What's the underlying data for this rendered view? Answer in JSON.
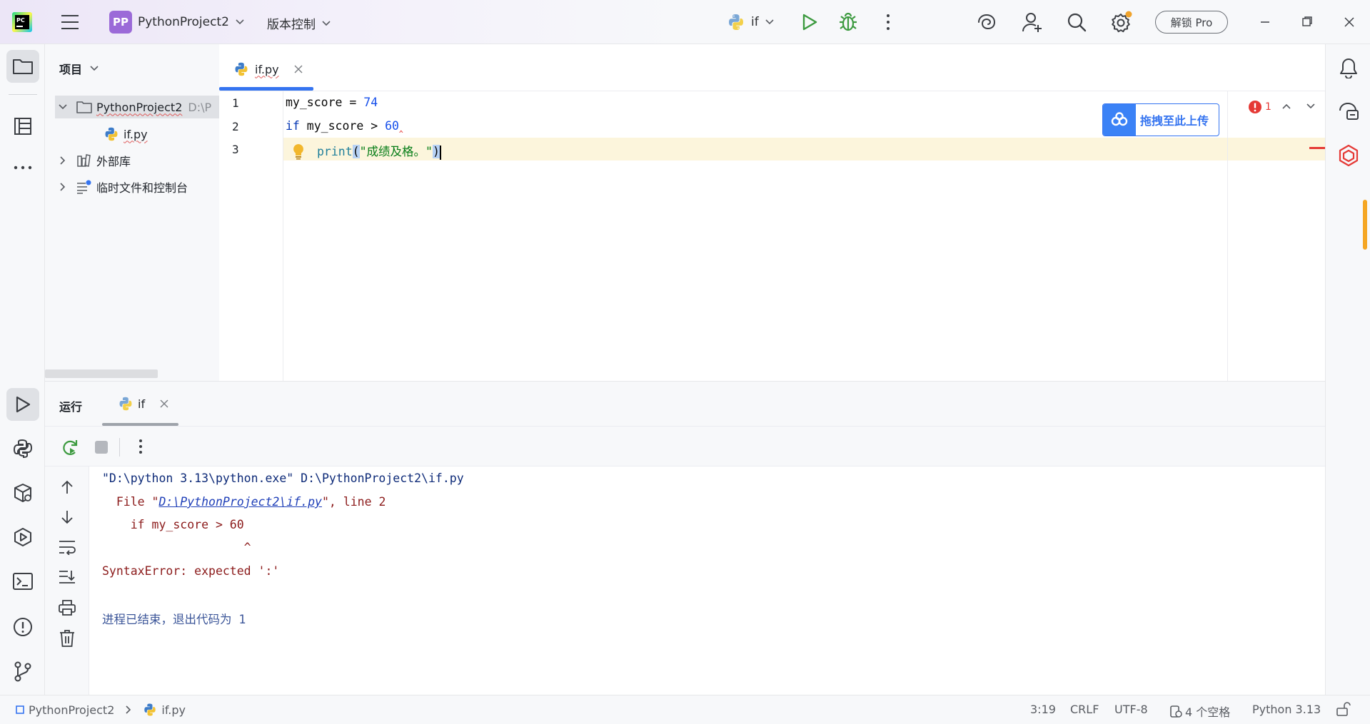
{
  "titlebar": {
    "project_badge": "PP",
    "project_name": "PythonProject2",
    "vcs_label": "版本控制",
    "run_config": "if",
    "pro_button": "解锁 Pro"
  },
  "project_panel": {
    "title": "项目",
    "root_name": "PythonProject2",
    "root_path": "D:\\P",
    "file_name": "if.py",
    "external_libs": "外部库",
    "scratches": "临时文件和控制台"
  },
  "editor": {
    "tab_label": "if.py",
    "error_count": "1",
    "upload_button": "拖拽至此上传",
    "line_numbers": [
      "1",
      "2",
      "3"
    ],
    "code": {
      "l1_var": "my_score",
      "l1_op": " = ",
      "l1_num": "74",
      "l2_kw": "if",
      "l2_var": " my_score ",
      "l2_op": ">",
      "l2_num": " 60",
      "l3_fn": "print",
      "l3_open": "(",
      "l3_str": "\"成绩及格。\"",
      "l3_close": ")"
    }
  },
  "run_panel": {
    "title": "运行",
    "tab_label": "if",
    "console": {
      "line1": "\"D:\\python 3.13\\python.exe\" D:\\PythonProject2\\if.py",
      "line2_pre": "  File \"",
      "line2_link": "D:\\PythonProject2\\if.py",
      "line2_post": "\", line 2",
      "line3": "    if my_score > 60",
      "line4": "                    ^",
      "line5": "SyntaxError: expected ':'",
      "line6": "进程已结束，退出代码为 1"
    }
  },
  "statusbar": {
    "crumb_project": "PythonProject2",
    "crumb_file": "if.py",
    "position": "3:19",
    "line_ending": "CRLF",
    "encoding": "UTF-8",
    "indent": "4 个空格",
    "interpreter": "Python 3.13"
  },
  "colors": {
    "accent": "#3574f0",
    "error": "#e53935",
    "badge": "#9b6ad8",
    "current_line": "#fcf5dc"
  }
}
